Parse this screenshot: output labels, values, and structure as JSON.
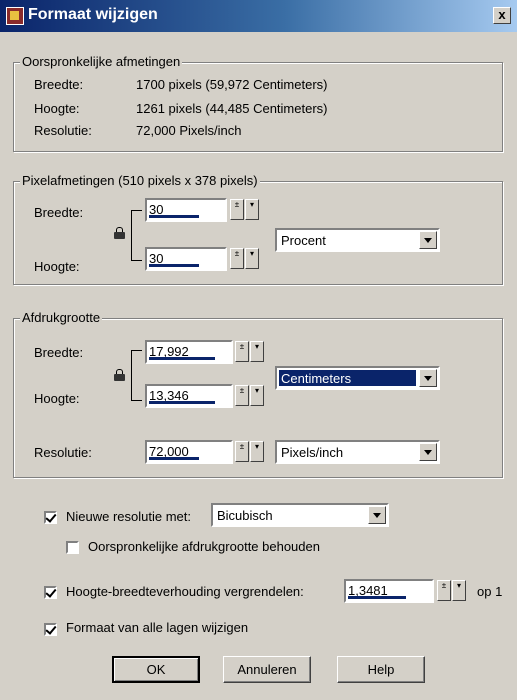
{
  "window": {
    "title": "Formaat wijzigen",
    "close": "x"
  },
  "original": {
    "legend": "Oorspronkelijke afmetingen",
    "breedte_label": "Breedte:",
    "breedte_value": "1700 pixels (59,972 Centimeters)",
    "hoogte_label": "Hoogte:",
    "hoogte_value": "1261 pixels (44,485 Centimeters)",
    "resolutie_label": "Resolutie:",
    "resolutie_value": "72,000 Pixels/inch"
  },
  "pixel": {
    "legend": "Pixelafmetingen (510 pixels x 378 pixels)",
    "breedte_label": "Breedte:",
    "breedte_value": "30",
    "hoogte_label": "Hoogte:",
    "hoogte_value": "30",
    "unit": "Procent"
  },
  "print": {
    "legend": "Afdrukgrootte",
    "breedte_label": "Breedte:",
    "breedte_value": "17,992",
    "hoogte_label": "Hoogte:",
    "hoogte_value": "13,346",
    "unit": "Centimeters",
    "resolutie_label": "Resolutie:",
    "resolutie_value": "72,000",
    "resolutie_unit": "Pixels/inch"
  },
  "options": {
    "resample_label": "Nieuwe resolutie met:",
    "resample_checked": true,
    "resample_method": "Bicubisch",
    "keep_print_label": "Oorspronkelijke afdrukgrootte behouden",
    "keep_print_checked": false,
    "aspect_label": "Hoogte-breedteverhouding vergrendelen:",
    "aspect_checked": true,
    "aspect_value": "1,3481",
    "aspect_suffix": "op 1",
    "all_layers_label": "Formaat van alle lagen wijzigen",
    "all_layers_checked": true
  },
  "buttons": {
    "ok": "OK",
    "cancel": "Annuleren",
    "help": "Help"
  }
}
